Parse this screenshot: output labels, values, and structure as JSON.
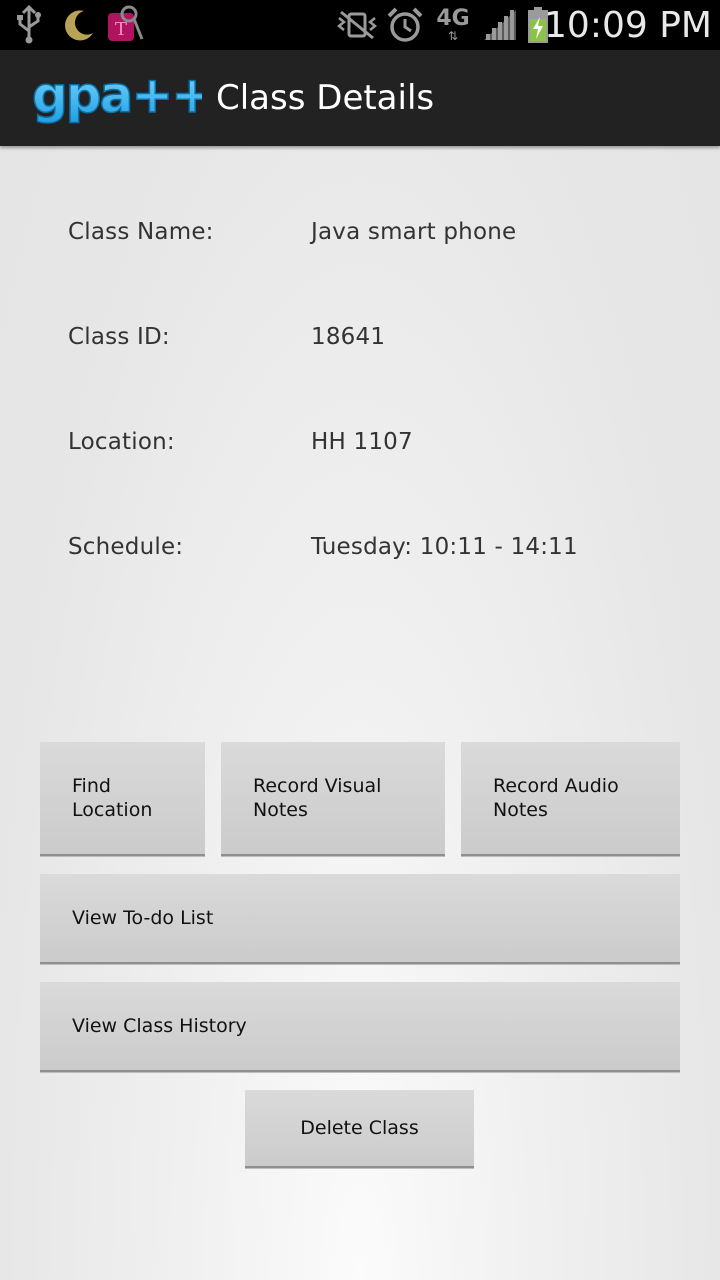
{
  "status_bar": {
    "time": "10:09 PM",
    "icons": [
      "usb-icon",
      "moon-icon",
      "tmobile-icon",
      "vibrate-mute-icon",
      "alarm-icon",
      "4g-icon",
      "signal-icon",
      "battery-charging-icon"
    ],
    "network_label": "4G",
    "carrier_letter": "T"
  },
  "action_bar": {
    "logo_text": "gpa++",
    "title": "Class Details"
  },
  "details": {
    "class_name_label": "Class Name:",
    "class_name_value": "Java smart phone",
    "class_id_label": "Class ID:",
    "class_id_value": "18641",
    "location_label": "Location:",
    "location_value": "HH 1107",
    "schedule_label": "Schedule:",
    "schedule_value": "Tuesday: 10:11 - 14:11"
  },
  "buttons": {
    "find_location": "Find\nLocation",
    "record_visual_notes": "Record Visual\nNotes",
    "record_audio_notes": "Record Audio\nNotes",
    "view_todo_list": "View To-do List",
    "view_class_history": "View Class History",
    "delete_class": "Delete Class"
  },
  "colors": {
    "status_bar_bg": "#000000",
    "action_bar_bg": "#222222",
    "logo_blue": "#33b5e5",
    "battery_green": "#8bc34a"
  }
}
